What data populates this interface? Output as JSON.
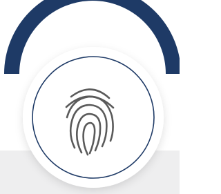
{
  "badge": {
    "icon": "fingerprint-icon",
    "colors": {
      "arc": "#1e3a66",
      "ring": "#1e3a66",
      "icon": "#5a5a5a",
      "background": "#ffffff",
      "floor": "#eeeeef"
    }
  }
}
